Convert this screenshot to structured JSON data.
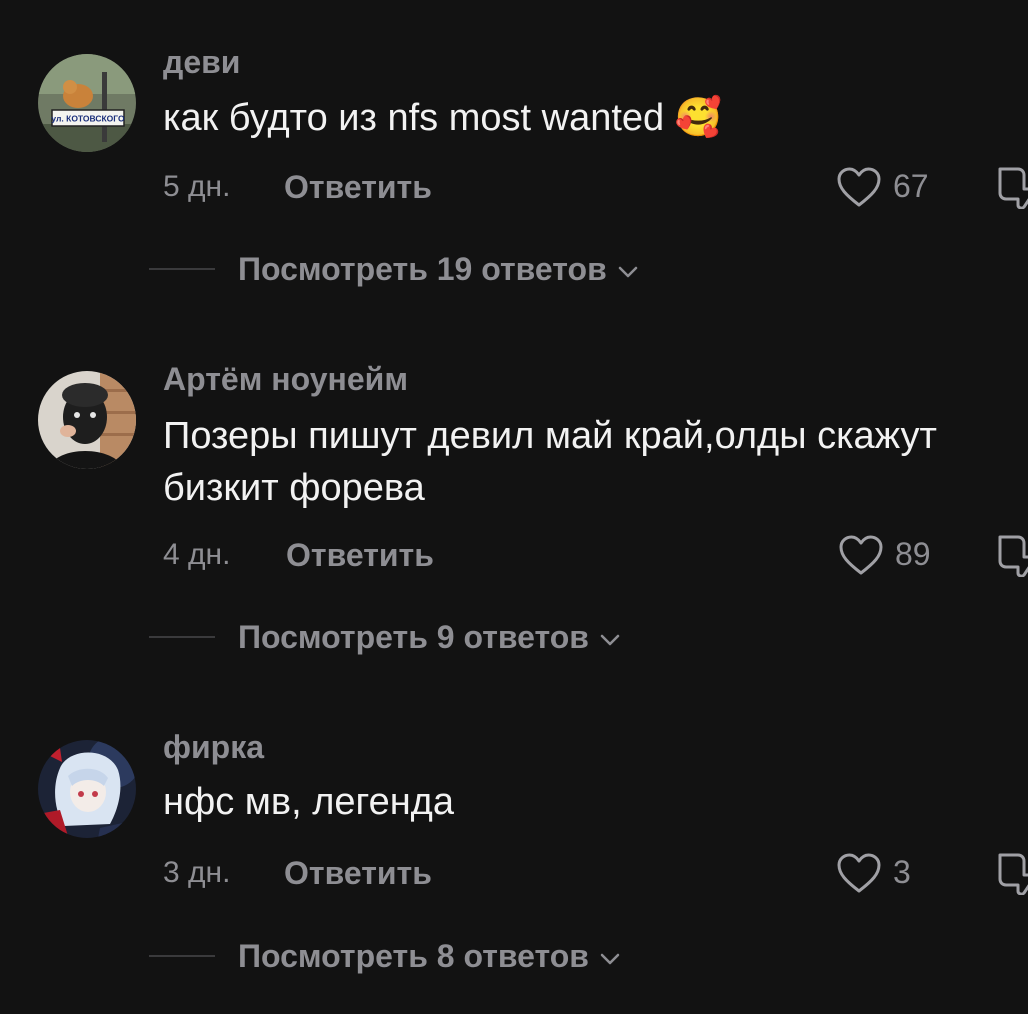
{
  "comments": [
    {
      "username": "деви",
      "text_lines": [
        "как будто из nfs most wanted 🥰"
      ],
      "time": "5 дн.",
      "reply_label": "Ответить",
      "likes": "67",
      "replies_label": "Посмотреть 19 ответов",
      "avatar_sign_text": "ул. КОТОВСКОГО"
    },
    {
      "username": "Артём ноунейм",
      "text_lines": [
        "Позеры пишут девил май край,олды скажут",
        "бизкит форева"
      ],
      "time": "4 дн.",
      "reply_label": "Ответить",
      "likes": "89",
      "replies_label": "Посмотреть 9 ответов"
    },
    {
      "username": "фирка",
      "text_lines": [
        "нфс мв, легенда"
      ],
      "time": "3 дн.",
      "reply_label": "Ответить",
      "likes": "3",
      "replies_label": "Посмотреть 8 ответов"
    }
  ],
  "icons": {
    "like": "heart-outline-icon",
    "dislike": "thumbs-down-outline-icon",
    "expand": "chevron-down-icon"
  },
  "colors": {
    "background": "#121212",
    "secondary_text": "#8e8e93",
    "primary_text": "#f2f2f2"
  }
}
